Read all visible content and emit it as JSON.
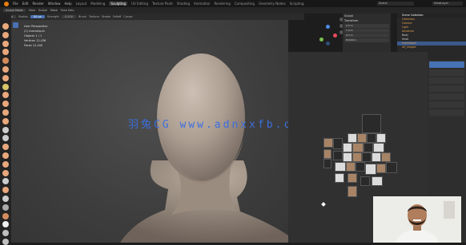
{
  "topbar": {
    "menus": [
      "File",
      "Edit",
      "Render",
      "Window",
      "Help"
    ],
    "tabs": [
      "Layout",
      "Modeling",
      "Sculpting",
      "UV Editing",
      "Texture Paint",
      "Shading",
      "Animation",
      "Rendering",
      "Compositing",
      "Geometry Nodes",
      "Scripting"
    ],
    "active_tab": "Sculpting",
    "scene": "Scene",
    "view_layer": "ViewLayer"
  },
  "subbar": {
    "mode": "Sculpt Mode",
    "items": [
      "View",
      "Sculpt",
      "Mask",
      "Face Sets"
    ]
  },
  "toolbar": {
    "brush": "Draw",
    "radius_label": "Radius",
    "radius_value": "50 px",
    "strength_label": "Strength",
    "strength_value": "0.500",
    "menus": [
      "Brush",
      "Texture",
      "Stroke",
      "Falloff",
      "Cursor"
    ]
  },
  "viewport_info": {
    "line1": "User Perspective",
    "line2": "(1) mannequin",
    "line3_label": "Objects",
    "line3_value": "1 / 1",
    "line4_label": "Vertices",
    "line4_value": "12,436",
    "line5_label": "Faces",
    "line5_value": "12,440"
  },
  "watermark": "羽兔CG  www.adnxxfb.cn",
  "npanel": {
    "header": "Sculpt",
    "section": "Transform",
    "rows": [
      "X  0 m",
      "Y  0 m",
      "Z  0 m",
      "Rotation"
    ]
  },
  "outliner": {
    "header": "Scene Collection",
    "items": [
      {
        "label": "Collection",
        "state": "on"
      },
      {
        "label": "Camera",
        "state": "on"
      },
      {
        "label": "Light",
        "state": "on"
      },
      {
        "label": "Armature",
        "state": "on"
      },
      {
        "label": "Body",
        "state": "off"
      },
      {
        "label": "Head",
        "state": "off"
      },
      {
        "label": "mannequin",
        "state": "on"
      },
      {
        "label": "ref_images",
        "state": "on"
      }
    ]
  },
  "colors": {
    "accent": "#4772b3",
    "logo": "#e87d0d",
    "viewport_bg": "#404040",
    "watermark": "#3b6fe0",
    "mannequin": "#b7a89b"
  },
  "brush_icon_colors": [
    "#e8a87c",
    "#e8a87c",
    "#e8a87c",
    "#e8a87c",
    "#d38b5d",
    "#e8a87c",
    "#e8a87c",
    "#d7c66c",
    "#e8a87c",
    "#e8a87c",
    "#e8a87c",
    "#e8a87c",
    "#cccccc",
    "#cccccc",
    "#e8a87c",
    "#e8a87c",
    "#e8a87c",
    "#e8a87c",
    "#cccccc",
    "#e8a87c",
    "#cccccc",
    "#aaaaaa",
    "#d38b5d",
    "#eeeeee",
    "#c0c0c0",
    "#c0c0c0"
  ]
}
